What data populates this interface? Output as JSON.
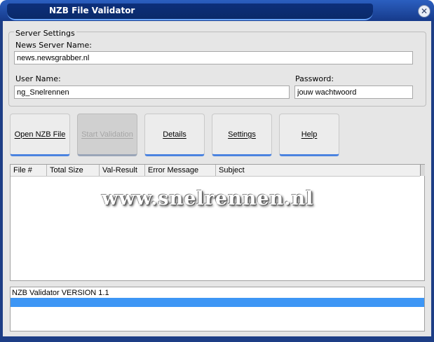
{
  "window": {
    "title": "NZB File Validator",
    "close_glyph": "✕"
  },
  "server_settings": {
    "group_label": "Server Settings",
    "news_server_label": "News Server Name:",
    "news_server_value": "news.newsgrabber.nl",
    "user_name_label": "User Name:",
    "user_name_value": "ng_Snelrennen",
    "password_label": "Password:",
    "password_value": "jouw wachtwoord"
  },
  "buttons": {
    "open": "Open NZB File",
    "start": "Start Validation",
    "details": "Details",
    "settings": "Settings",
    "help": "Help"
  },
  "results": {
    "columns": [
      "File #",
      "Total Size",
      "Val-Result",
      "Error Message",
      "Subject"
    ]
  },
  "watermark": "www.snelrennen.nl",
  "log": {
    "lines": [
      "NZB Validator VERSION 1.1"
    ]
  },
  "colors": {
    "title_bar": "#163a8a",
    "button_accent": "#4b83e0",
    "selection": "#3d96f5"
  }
}
